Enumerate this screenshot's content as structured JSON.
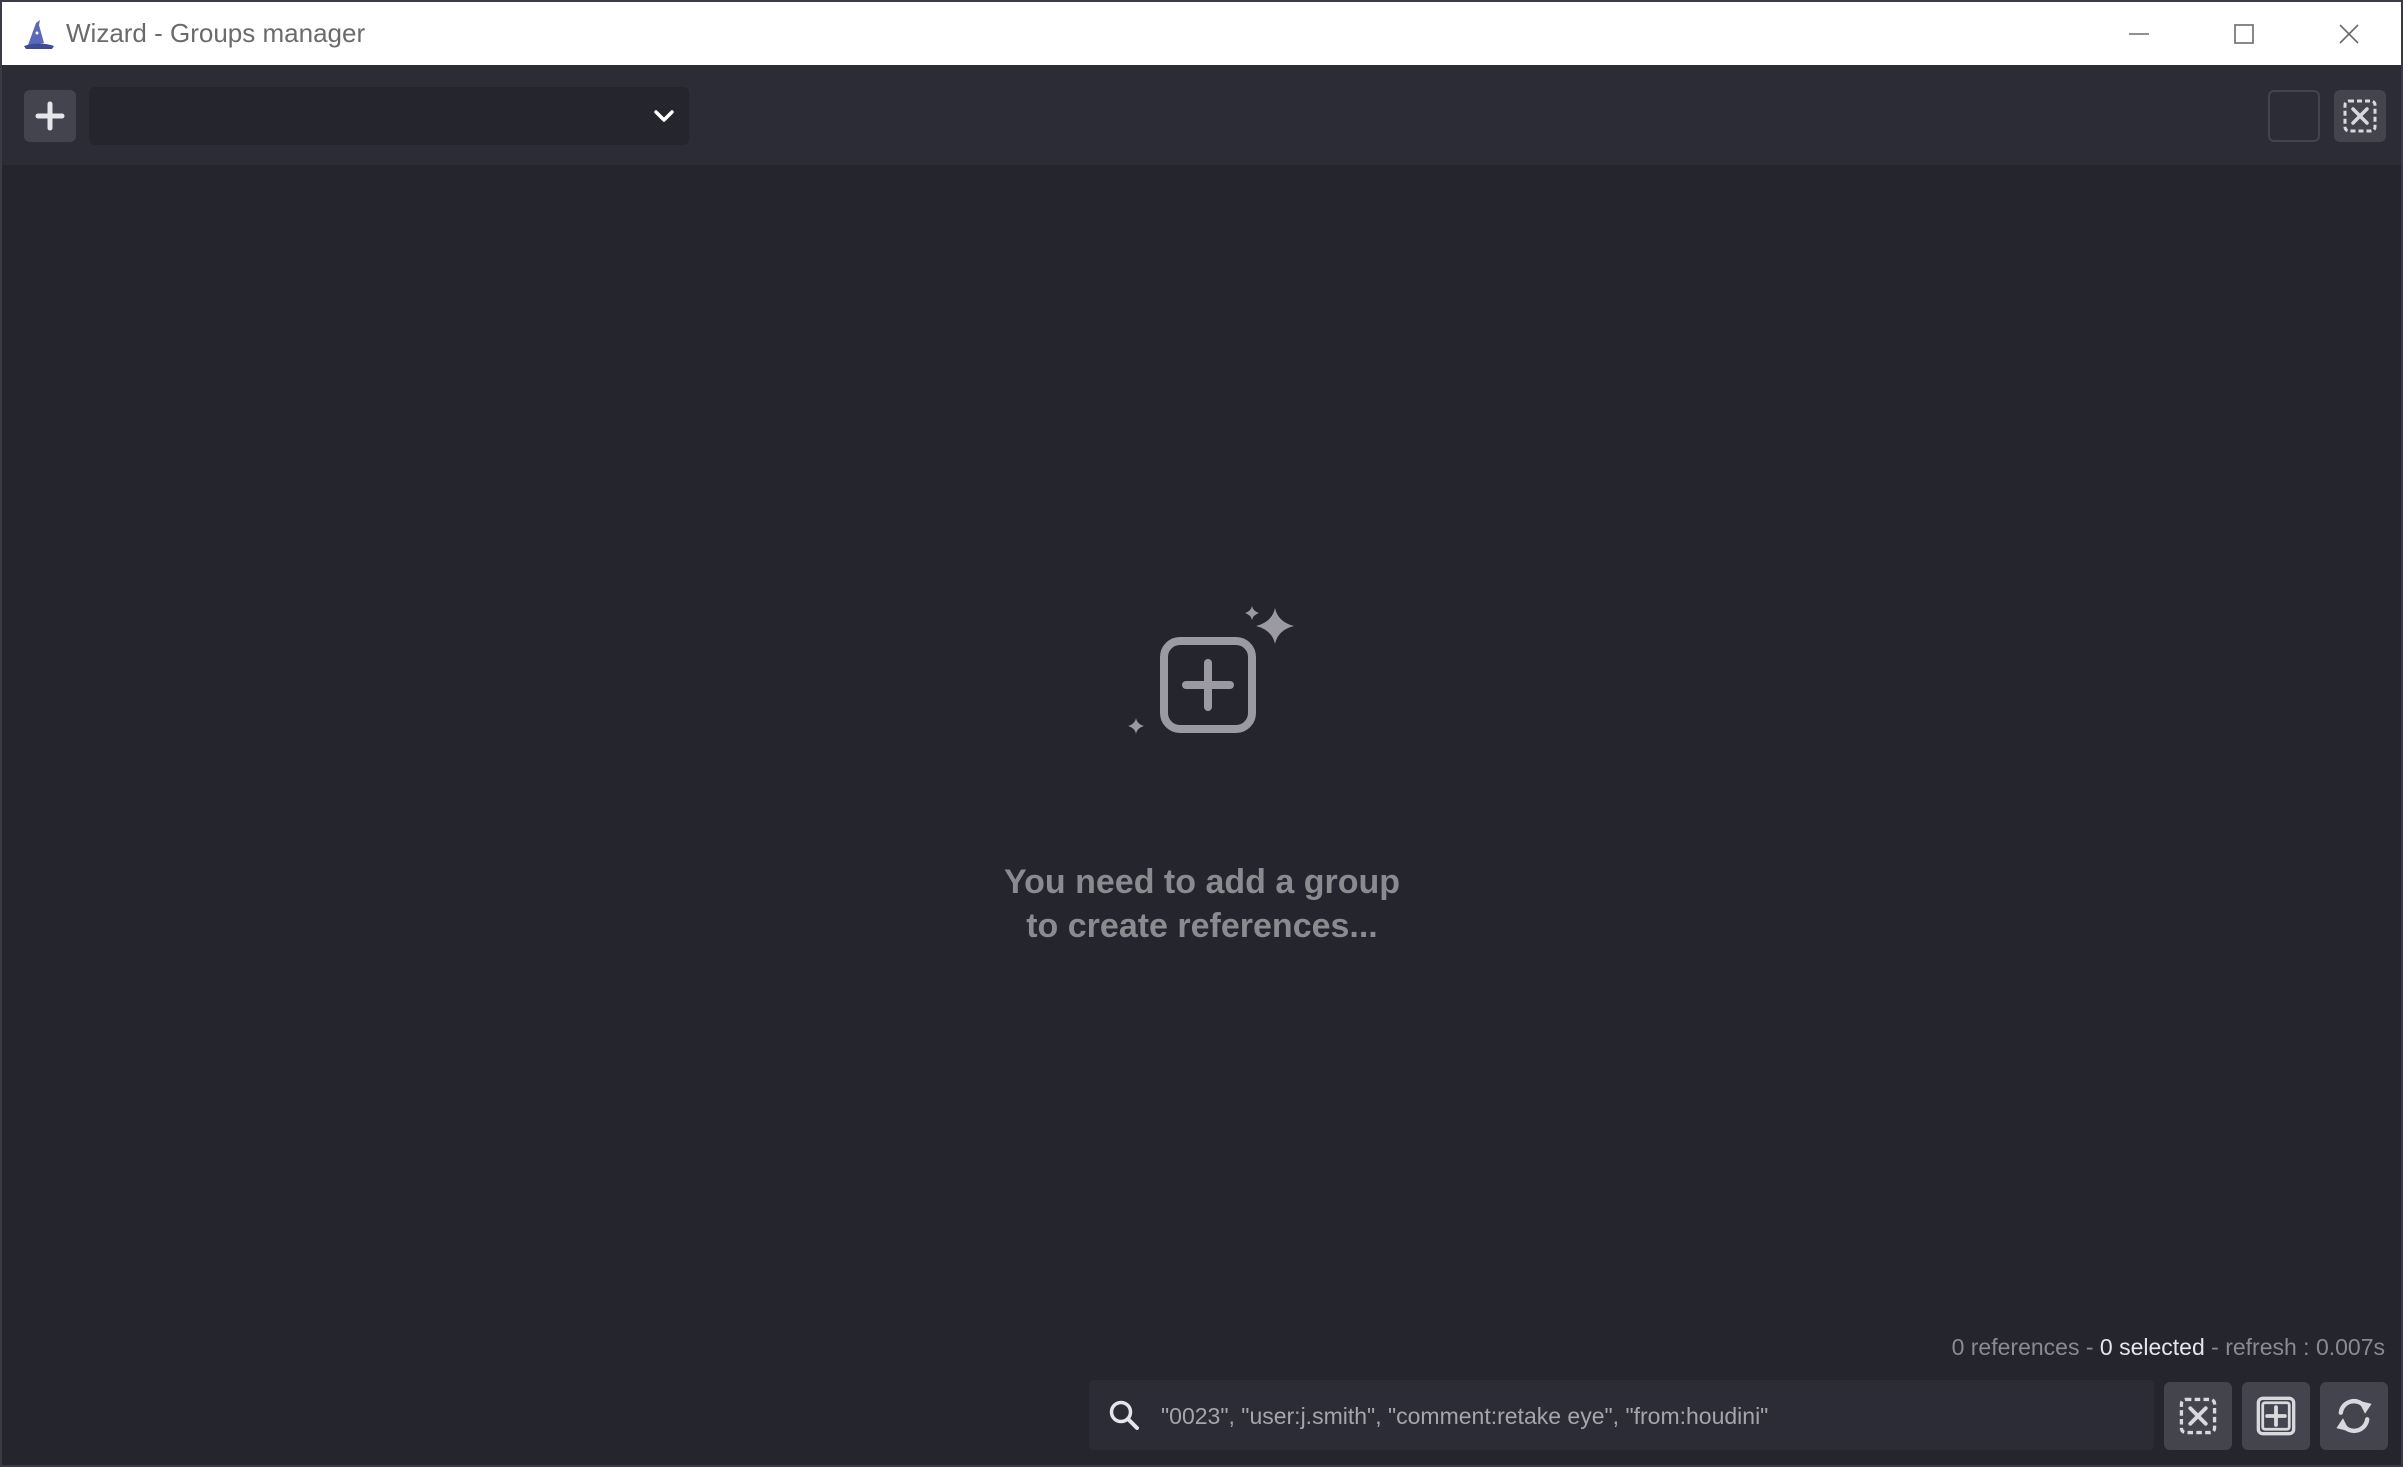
{
  "window": {
    "title": "Wizard - Groups manager",
    "app_icon": "wizard-hat-icon"
  },
  "toolbar": {
    "add_group_icon": "plus-icon",
    "group_select_value": "",
    "dropdown_icon": "chevron-down-icon",
    "clear_icon": "clear-selection-icon"
  },
  "empty_state": {
    "icon": "add-box-sparkles-icon",
    "line1": "You need to add a group",
    "line2": "to create references..."
  },
  "status": {
    "references": "0 references -",
    "selected": "0 selected",
    "refresh": "- refresh : 0.007s"
  },
  "search": {
    "placeholder": "\"0023\", \"user:j.smith\", \"comment:retake eye\", \"from:houdini\"",
    "value": ""
  },
  "colors": {
    "background": "#24252d",
    "toolbar": "#2b2c35",
    "button": "#43444d",
    "muted_text": "#8a8a8f"
  }
}
